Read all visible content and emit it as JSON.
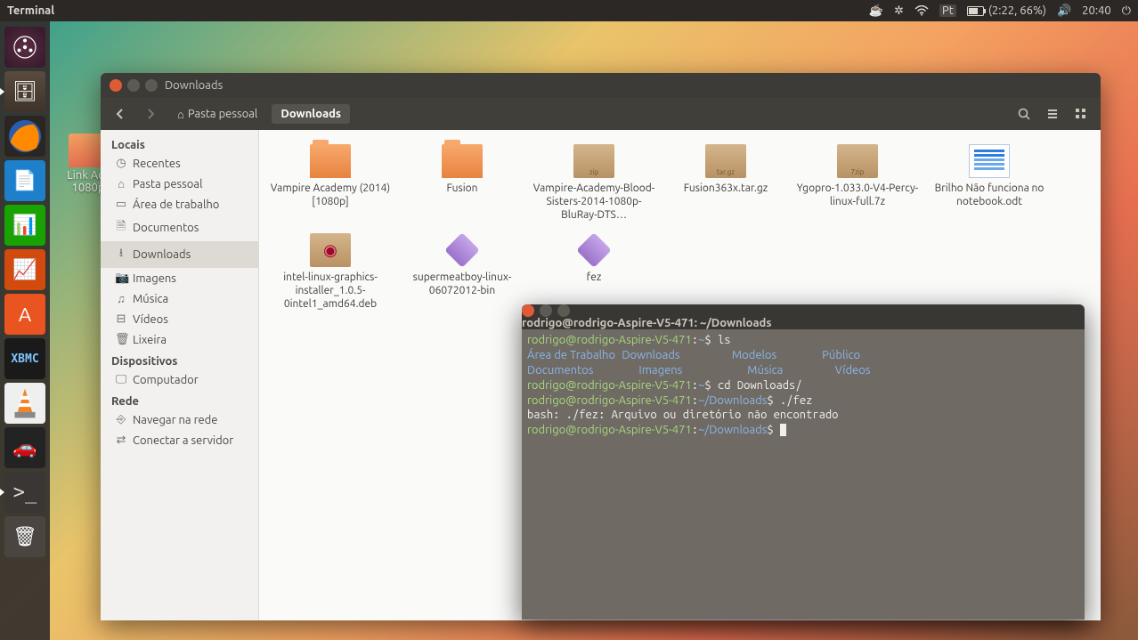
{
  "topbar": {
    "app": "Terminal",
    "keyboard": "Pt",
    "battery": "(2:22, 66%)",
    "time": "20:40"
  },
  "launcher": [
    {
      "name": "dash",
      "hint": "Dash"
    },
    {
      "name": "files",
      "hint": "Files",
      "running": true
    },
    {
      "name": "firefox",
      "hint": "Firefox"
    },
    {
      "name": "writer",
      "hint": "LibreOffice Writer"
    },
    {
      "name": "calc",
      "hint": "LibreOffice Calc"
    },
    {
      "name": "impress",
      "hint": "LibreOffice Impress"
    },
    {
      "name": "software",
      "hint": "Ubuntu Software"
    },
    {
      "name": "xbmc",
      "hint": "XBMC"
    },
    {
      "name": "vlc",
      "hint": "VLC"
    },
    {
      "name": "car",
      "hint": "Game"
    },
    {
      "name": "terminal",
      "hint": "Terminal",
      "running": true
    },
    {
      "name": "trash",
      "hint": "Trash"
    }
  ],
  "desktop_icon": {
    "label": "Link Aca 1080p"
  },
  "nautilus": {
    "title": "Downloads",
    "path_home": "Pasta pessoal",
    "path_current": "Downloads",
    "sidebar": {
      "locais": "Locais",
      "items1": [
        {
          "icon": "◷",
          "label": "Recentes"
        },
        {
          "icon": "⌂",
          "label": "Pasta pessoal"
        },
        {
          "icon": "▭",
          "label": "Área de trabalho"
        },
        {
          "icon": "🗎",
          "label": "Documentos"
        },
        {
          "icon": "⭳",
          "label": "Downloads",
          "active": true
        },
        {
          "icon": "📷",
          "label": "Imagens"
        },
        {
          "icon": "♫",
          "label": "Música"
        },
        {
          "icon": "⊟",
          "label": "Vídeos"
        },
        {
          "icon": "🗑",
          "label": "Lixeira"
        }
      ],
      "dispositivos": "Dispositivos",
      "items2": [
        {
          "icon": "🖵",
          "label": "Computador"
        }
      ],
      "rede": "Rede",
      "items3": [
        {
          "icon": "⎆",
          "label": "Navegar na rede"
        },
        {
          "icon": "⇄",
          "label": "Conectar a servidor"
        }
      ]
    },
    "files": [
      {
        "type": "folder",
        "label": "Vampire Academy (2014) [1080p]"
      },
      {
        "type": "folder",
        "label": "Fusion"
      },
      {
        "type": "zip",
        "label": "Vampire-Academy-Blood-Sisters-2014-1080p-BluRay-DTS…",
        "badge": "zip"
      },
      {
        "type": "targz",
        "label": "Fusion363x.tar.gz",
        "badge": "tar.gz"
      },
      {
        "type": "7z",
        "label": "Ygopro-1.033.0-V4-Percy-linux-full.7z",
        "badge": "7zip"
      },
      {
        "type": "doc",
        "label": "Brilho Não funciona no notebook.odt"
      },
      {
        "type": "deb",
        "label": "intel-linux-graphics-installer_1.0.5-0intel1_amd64.deb"
      },
      {
        "type": "exec",
        "label": "supermeatboy-linux-06072012-bin"
      },
      {
        "type": "exec",
        "label": "fez"
      }
    ]
  },
  "terminal": {
    "title": "rodrigo@rodrigo-Aspire-V5-471: ~/Downloads",
    "lines": [
      {
        "prompt": "rodrigo@rodrigo-Aspire-V5-471",
        "path": "~",
        "cmd": "ls"
      },
      {
        "dirs": [
          "Área de Trabalho",
          "Downloads",
          "Modelos",
          "Público"
        ]
      },
      {
        "dirs": [
          "Documentos",
          "Imagens",
          "Música",
          "Vídeos"
        ]
      },
      {
        "prompt": "rodrigo@rodrigo-Aspire-V5-471",
        "path": "~",
        "cmd": "cd Downloads/"
      },
      {
        "prompt": "rodrigo@rodrigo-Aspire-V5-471",
        "path": "~/Downloads",
        "cmd": "./fez"
      },
      {
        "text": "bash: ./fez: Arquivo ou diretório não encontrado"
      },
      {
        "prompt": "rodrigo@rodrigo-Aspire-V5-471",
        "path": "~/Downloads",
        "cmd": "",
        "cursor": true
      }
    ]
  }
}
